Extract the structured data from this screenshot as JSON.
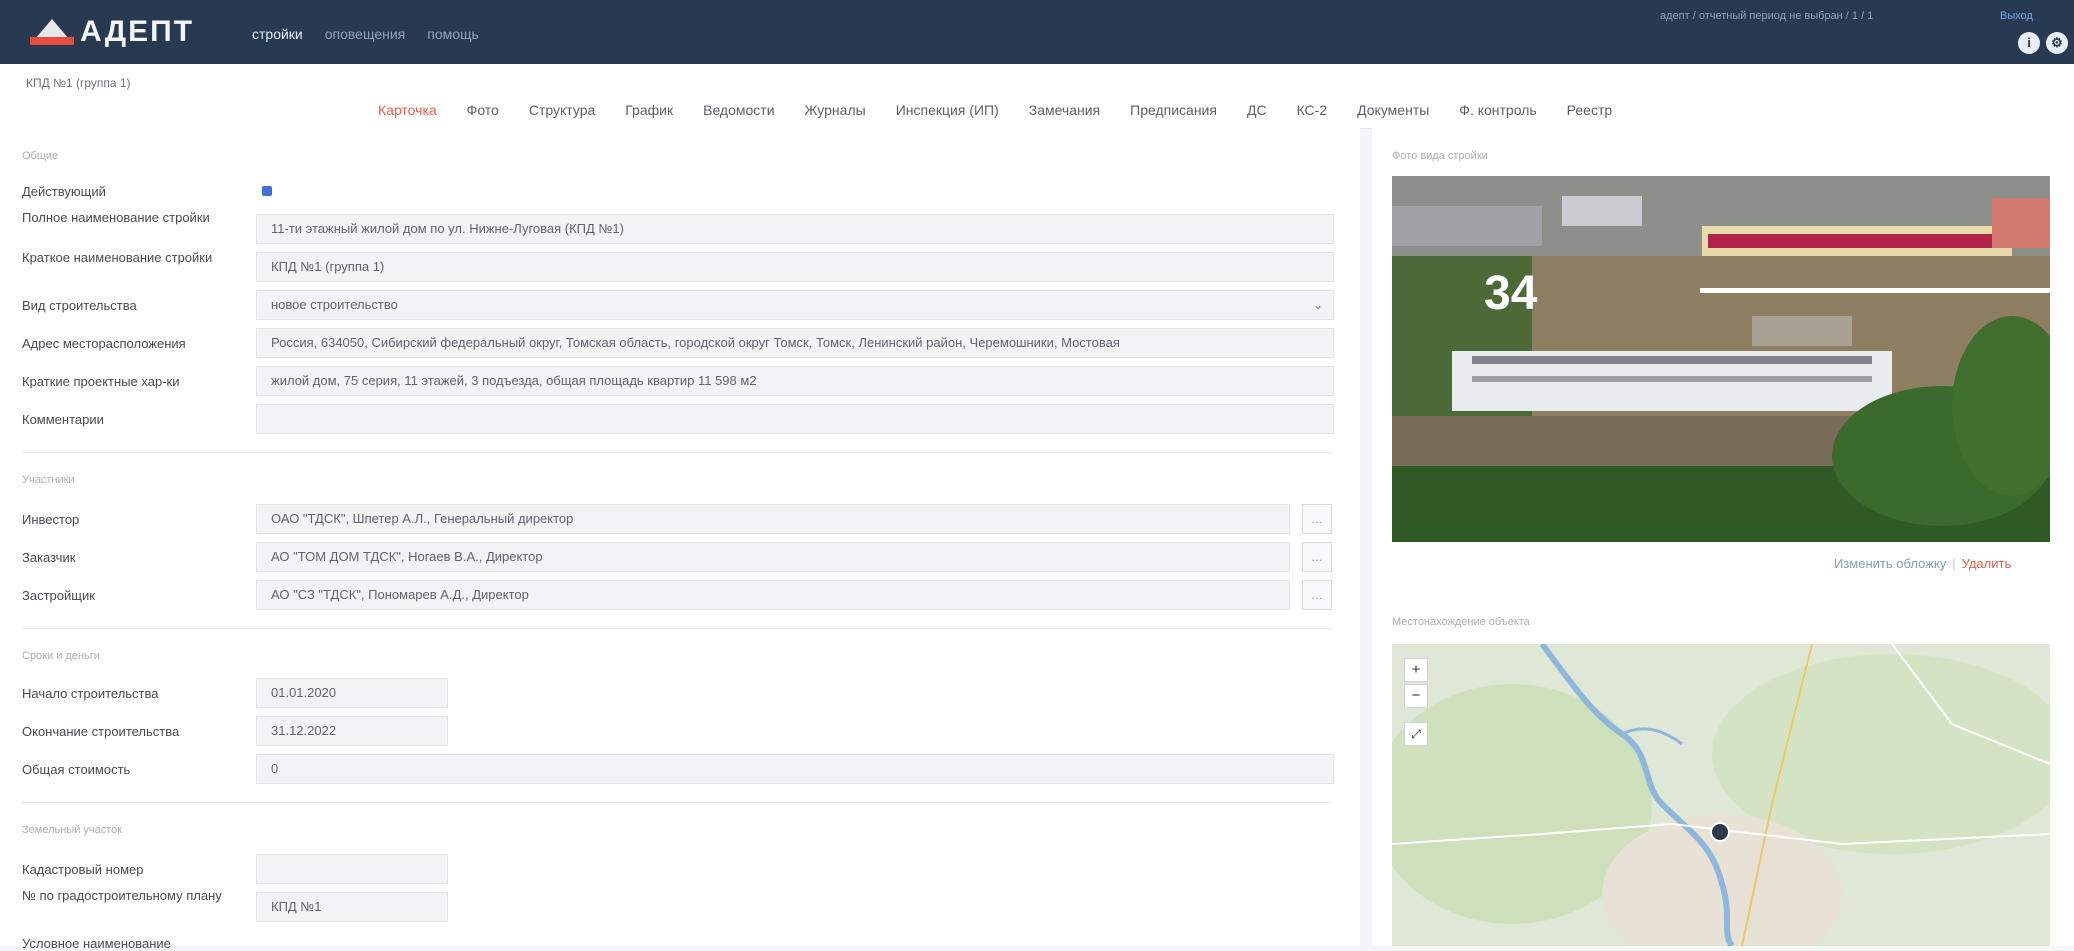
{
  "app": {
    "logo_text": "АДЕПТ",
    "nav": [
      {
        "label": "стройки",
        "active": true
      },
      {
        "label": "оповещения",
        "active": false
      },
      {
        "label": "помощь",
        "active": false
      }
    ],
    "user_info": "адепт / отчетный период не выбран / 1 / 1",
    "user_link": "Выход"
  },
  "object": {
    "breadcrumb": "КПД №1 (группа 1)"
  },
  "tabs": [
    {
      "label": "Карточка",
      "active": true
    },
    {
      "label": "Фото",
      "active": false
    },
    {
      "label": "Структура",
      "active": false
    },
    {
      "label": "График",
      "active": false
    },
    {
      "label": "Ведомости",
      "active": false
    },
    {
      "label": "Журналы",
      "active": false
    },
    {
      "label": "Инспекция (ИП)",
      "active": false
    },
    {
      "label": "Замечания",
      "active": false
    },
    {
      "label": "Предписания",
      "active": false
    },
    {
      "label": "ДС",
      "active": false
    },
    {
      "label": "КС-2",
      "active": false
    },
    {
      "label": "Документы",
      "active": false
    },
    {
      "label": "Ф. контроль",
      "active": false
    },
    {
      "label": "Реестр",
      "active": false
    }
  ],
  "sections": {
    "general": "Общие",
    "participants": "Участники",
    "terms": "Сроки и деньги",
    "cadastral": "Земельный участок"
  },
  "fields": {
    "active_label": "Действующий",
    "full_name_label": "Полное наименование стройки",
    "full_name_value": "11-ти этажный жилой дом по ул. Нижне-Луговая (КПД №1)",
    "short_name_label": "Краткое наименование стройки",
    "short_name_value": "КПД №1 (группа 1)",
    "type_label": "Вид строительства",
    "type_value": "новое строительство",
    "address_label": "Адрес месторасположения",
    "address_value": "Россия, 634050, Сибирский федеральный округ, Томская область, городской округ Томск, Томск, Ленинский район, Черемошники, Мостовая",
    "specs_label": "Краткие проектные хар-ки",
    "specs_value": "жилой дом, 75 серия, 11 этажей, 3 подъезда, общая площадь квартир 11 598 м2",
    "comment_label": "Комментарии",
    "comment_value": "",
    "investor_label": "Инвестор",
    "investor_value": "ОАО \"ТДСК\", Шпетер А.Л., Генеральный директор",
    "customer_label": "Заказчик",
    "customer_value": "АО \"ТОМ ДОМ ТДСК\", Ногаев В.А., Директор",
    "developer_label": "Застройщик",
    "developer_value": "АО \"СЗ \"ТДСК\", Пономарев А.Д., Директор",
    "start_label": "Начало строительства",
    "start_value": "01.01.2020",
    "end_label": "Окончание строительства",
    "end_value": "31.12.2022",
    "cost_label": "Общая стоимость",
    "cost_value": "0",
    "cadastral_label": "Кадастровый номер",
    "cadastral_value": "",
    "plan_label": "№ по градостроительному плану",
    "plan_value": "КПД №1",
    "next_label": "Условное наименование"
  },
  "photo": {
    "title": "Фото вида стройки",
    "overlay": "34",
    "change_label": "Изменить обложку",
    "delete_label": "Удалить"
  },
  "map": {
    "title": "Местонахождение объекта"
  },
  "colors": {
    "header_bg": "#283a52",
    "accent_tab": "#e8604c",
    "link": "#7f9dc4",
    "checkbox": "#3f6fd8"
  }
}
